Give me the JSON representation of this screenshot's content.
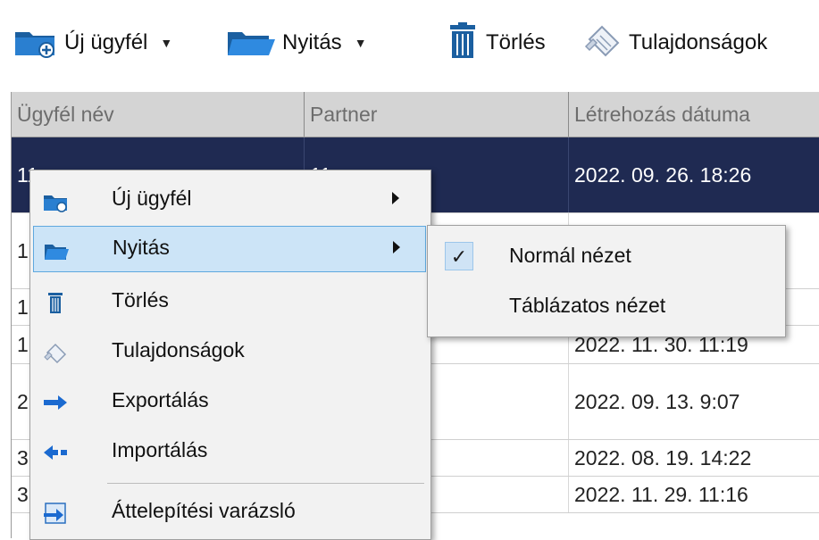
{
  "toolbar": {
    "new_client": "Új ügyfél",
    "open": "Nyitás",
    "delete": "Törlés",
    "properties": "Tulajdonságok"
  },
  "grid": {
    "columns": [
      "Ügyfél név",
      "Partner",
      "Létrehozás dátuma"
    ],
    "rows": [
      {
        "name": "11...",
        "partner": "11...",
        "date": "2022. 09. 26. 18:26",
        "selected": true
      },
      {
        "name": "1",
        "partner": "",
        "date": ""
      },
      {
        "name": "1",
        "partner": "",
        "date": ""
      },
      {
        "name": "1",
        "partner": "",
        "date": "2022. 11. 30. 11:19"
      },
      {
        "name": "2",
        "partner": "",
        "date": "2022. 09. 13. 9:07"
      },
      {
        "name": "3",
        "partner": "",
        "date": "2022. 08. 19. 14:22"
      },
      {
        "name": "3",
        "partner": "",
        "date": "2022. 11. 29. 11:16"
      }
    ]
  },
  "context_menu": {
    "items": [
      {
        "label": "Új ügyfél",
        "icon": "new-client-icon",
        "submenu": true
      },
      {
        "label": "Nyitás",
        "icon": "open-folder-icon",
        "submenu": true,
        "highlighted": true
      },
      {
        "label": "Törlés",
        "icon": "trash-icon"
      },
      {
        "label": "Tulajdonságok",
        "icon": "properties-icon"
      },
      {
        "label": "Exportálás",
        "icon": "export-icon"
      },
      {
        "label": "Importálás",
        "icon": "import-icon"
      },
      {
        "label": "Áttelepítési varázsló",
        "icon": "migration-wizard-icon"
      }
    ]
  },
  "submenu": {
    "items": [
      {
        "label": "Normál nézet",
        "checked": true,
        "check_glyph": "✓"
      },
      {
        "label": "Táblázatos nézet",
        "checked": false
      }
    ]
  },
  "colors": {
    "selected_row": "#1f2a52",
    "menu_highlight": "#cce4f7",
    "menu_bg": "#f2f2f2",
    "header_bg": "#d4d4d4"
  }
}
